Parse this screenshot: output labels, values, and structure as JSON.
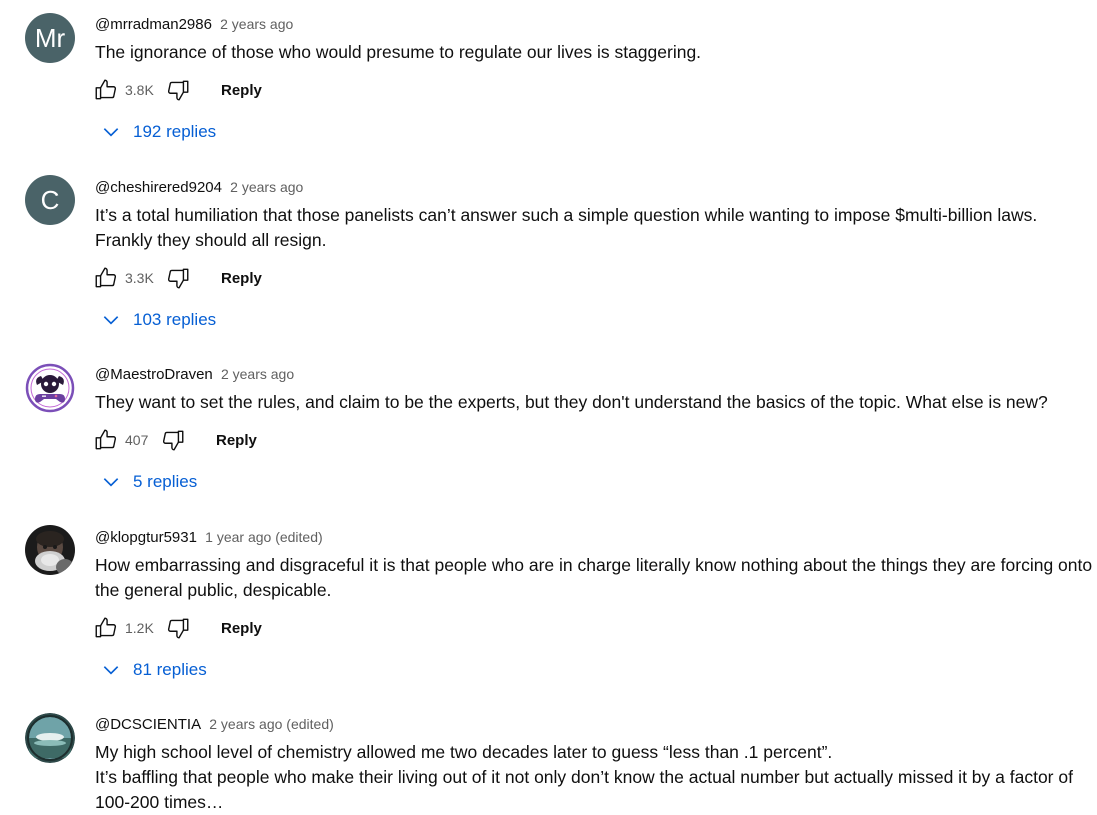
{
  "comments": [
    {
      "author": "@mrradman2986",
      "time": "2 years ago",
      "avatar_initials": "Mr",
      "text_lines": [
        "The ignorance of those who would presume to regulate our lives is staggering."
      ],
      "likes": "3.8K",
      "reply_label": "Reply",
      "replies_label": "192 replies"
    },
    {
      "author": "@cheshirered9204",
      "time": "2 years ago",
      "avatar_initials": "C",
      "text_lines": [
        "It’s a total humiliation that those panelists can’t answer such a simple question while wanting to impose $multi-billion laws.",
        "Frankly they should all resign."
      ],
      "likes": "3.3K",
      "reply_label": "Reply",
      "replies_label": "103 replies"
    },
    {
      "author": "@MaestroDraven",
      "time": "2 years ago",
      "avatar_initials": "",
      "text_lines": [
        "They want to set the rules, and claim to be the experts, but they don't understand the basics of the topic. What else is new?"
      ],
      "likes": "407",
      "reply_label": "Reply",
      "replies_label": "5 replies"
    },
    {
      "author": "@klopgtur5931",
      "time": "1 year ago (edited)",
      "avatar_initials": "",
      "text_lines": [
        "How embarrassing and disgraceful it is that people who are in charge literally know nothing about the things they are forcing onto",
        "the general public, despicable."
      ],
      "likes": "1.2K",
      "reply_label": "Reply",
      "replies_label": "81 replies"
    },
    {
      "author": "@DCSCIENTIA",
      "time": "2 years ago (edited)",
      "avatar_initials": "",
      "text_lines": [
        "My high school level of chemistry allowed me two decades later to guess “less than .1 percent”.",
        "It’s baffling that people who make their living out of it not only don’t know the actual number but actually missed it by a factor of",
        "100-200 times…"
      ]
    }
  ],
  "colors": {
    "link_blue": "#065fd4",
    "meta_gray": "#606060",
    "avatar_teal": "#4a6368"
  },
  "icons": {
    "like": "thumbs-up-icon",
    "dislike": "thumbs-down-icon",
    "expand": "chevron-down-icon"
  }
}
